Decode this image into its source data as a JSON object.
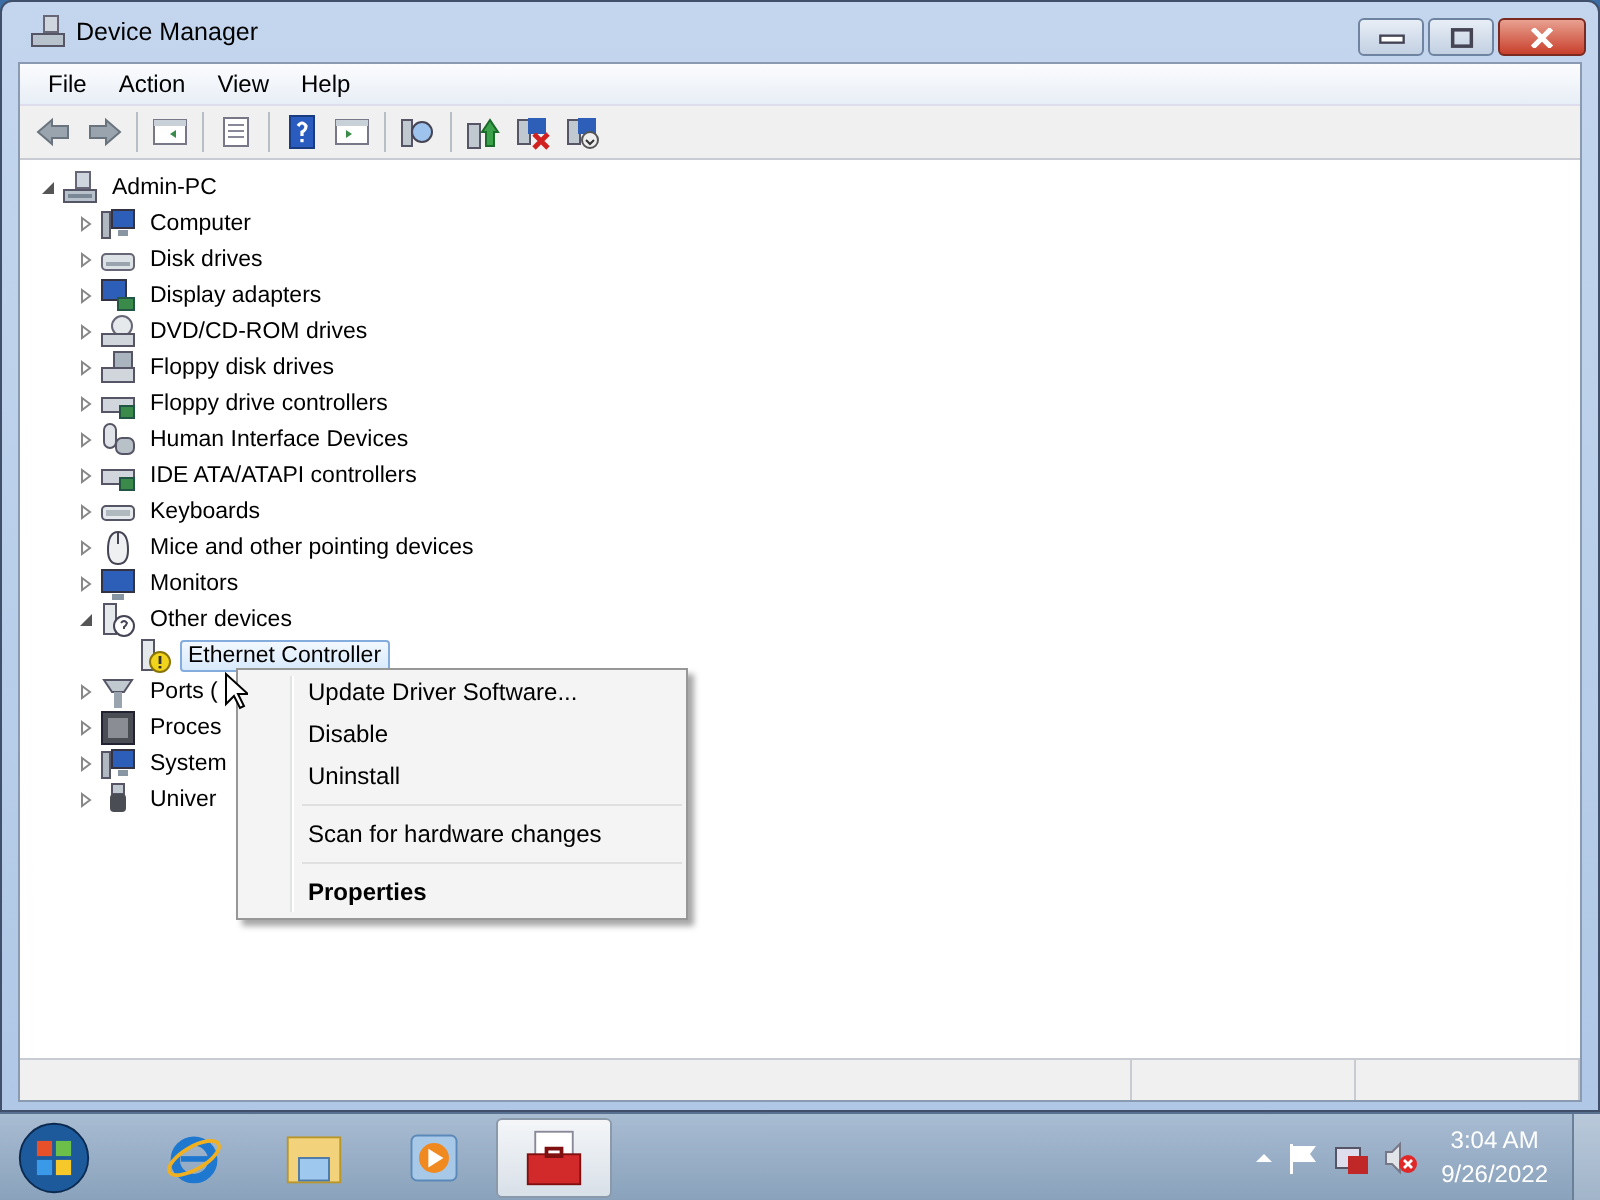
{
  "window": {
    "title": "Device Manager"
  },
  "menu": [
    "File",
    "Action",
    "View",
    "Help"
  ],
  "tree": {
    "label": "Admin-PC",
    "expanded": true,
    "selected": false,
    "children": [
      {
        "label": "Computer",
        "expanded": false,
        "selected": false
      },
      {
        "label": "Disk drives",
        "expanded": false,
        "selected": false
      },
      {
        "label": "Display adapters",
        "expanded": false,
        "selected": false
      },
      {
        "label": "DVD/CD-ROM drives",
        "expanded": false,
        "selected": false
      },
      {
        "label": "Floppy disk drives",
        "expanded": false,
        "selected": false
      },
      {
        "label": "Floppy drive controllers",
        "expanded": false,
        "selected": false
      },
      {
        "label": "Human Interface Devices",
        "expanded": false,
        "selected": false
      },
      {
        "label": "IDE ATA/ATAPI controllers",
        "expanded": false,
        "selected": false
      },
      {
        "label": "Keyboards",
        "expanded": false,
        "selected": false
      },
      {
        "label": "Mice and other pointing devices",
        "expanded": false,
        "selected": false
      },
      {
        "label": "Monitors",
        "expanded": false,
        "selected": false
      },
      {
        "label": "Other devices",
        "expanded": true,
        "selected": false,
        "children": [
          {
            "label": "Ethernet Controller",
            "selected": true
          }
        ]
      },
      {
        "label": "Ports (",
        "expanded": false,
        "selected": false
      },
      {
        "label": "Proces",
        "expanded": false,
        "selected": false
      },
      {
        "label": "System",
        "expanded": false,
        "selected": false
      },
      {
        "label": "Univer",
        "expanded": false,
        "selected": false
      }
    ]
  },
  "context_menu": [
    {
      "kind": "item",
      "label": "Update Driver Software..."
    },
    {
      "kind": "item",
      "label": "Disable"
    },
    {
      "kind": "item",
      "label": "Uninstall"
    },
    {
      "kind": "separator"
    },
    {
      "kind": "item",
      "label": "Scan for hardware changes"
    },
    {
      "kind": "separator"
    },
    {
      "kind": "default",
      "label": "Properties"
    }
  ],
  "taskbar": {
    "buttons": [
      {
        "selected": false
      },
      {
        "selected": false
      },
      {
        "selected": false
      },
      {
        "selected": true
      }
    ]
  },
  "clock": {
    "time": "3:04 AM",
    "date": "9/26/2022"
  }
}
